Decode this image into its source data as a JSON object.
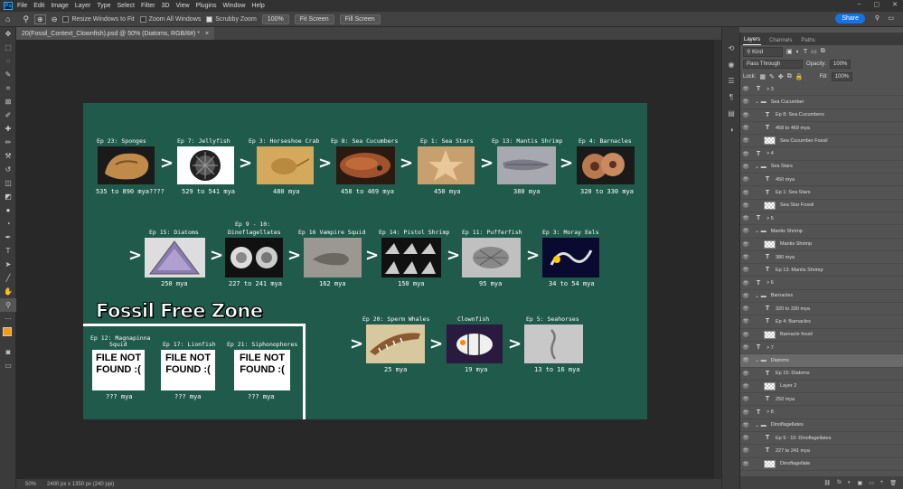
{
  "menubar": {
    "items": [
      "File",
      "Edit",
      "Image",
      "Layer",
      "Type",
      "Select",
      "Filter",
      "3D",
      "View",
      "Plugins",
      "Window",
      "Help"
    ]
  },
  "options": {
    "resize_windows": "Resize Windows to Fit",
    "zoom_all": "Zoom All Windows",
    "scrubby": "Scrubby Zoom",
    "zoom_pct": "100%",
    "fit_screen": "Fit Screen",
    "fill_screen": "Fill Screen",
    "share": "Share"
  },
  "document": {
    "tab": "20(Fossil_Context_Clownfish).psd @ 50% (Diatoms, RGB/8#) *",
    "close": "×"
  },
  "status": {
    "zoom": "50%",
    "info": "2400 px x 1350 px (240 ppi)"
  },
  "canvas": {
    "row1": [
      {
        "label": "Ep 23: Sponges",
        "mya": "535 to 890 mya????"
      },
      {
        "label": "Ep 7: Jellyfish",
        "mya": "529 to 541 mya"
      },
      {
        "label": "Ep 3: Horseshoe Crab",
        "mya": "480 mya"
      },
      {
        "label": "Ep 8: Sea Cucumbers",
        "mya": "458 to 469 mya"
      },
      {
        "label": "Ep 1: Sea Stars",
        "mya": "450 mya"
      },
      {
        "label": "Ep 13: Mantis Shrimp",
        "mya": "380 mya"
      },
      {
        "label": "Ep 4: Barnacles",
        "mya": "320 to 330 mya"
      }
    ],
    "row2": [
      {
        "label": "Ep 15: Diatoms",
        "mya": "250 mya"
      },
      {
        "label": "Ep 9 - 10:",
        "label2": "Dinoflagellates",
        "mya": "227 to 241 mya"
      },
      {
        "label": "Ep 16 Vampire Squid",
        "mya": "162 mya"
      },
      {
        "label": "Ep 14: Pistol Shrimp",
        "mya": "150 mya"
      },
      {
        "label": "Ep 11: Pufferfish",
        "mya": "95 mya"
      },
      {
        "label": "Ep 3: Moray Eels",
        "mya": "34 to 54 mya"
      }
    ],
    "row3": [
      {
        "label": "Ep 20: Sperm Whales",
        "mya": "25 mya"
      },
      {
        "label": "Clownfish",
        "mya": "19 mya"
      },
      {
        "label": "Ep 5: Seahorses",
        "mya": "13 to 16 mya"
      }
    ],
    "ffz_title": "Fossil Free Zone",
    "ffz": [
      {
        "label": "Ep 12: Magnapinna",
        "label2": "Squid",
        "nf": "FILE NOT FOUND :(",
        "mya": "??? mya"
      },
      {
        "label": "Ep 17: Lionfish",
        "nf": "FILE NOT FOUND :(",
        "mya": "??? mya"
      },
      {
        "label": "Ep 21: Siphonophores",
        "nf": "FILE NOT FOUND :(",
        "mya": "??? mya"
      }
    ],
    "arrow": ">"
  },
  "panel": {
    "tabs": [
      "Layers",
      "Channels",
      "Paths"
    ],
    "kind": "Kind",
    "blend": "Pass Through",
    "opacity_label": "Opacity:",
    "opacity": "100%",
    "lock_label": "Lock:",
    "fill_label": "Fill:",
    "fill": "100%",
    "layers": [
      {
        "type": "T",
        "name": "> 3",
        "indent": 0
      },
      {
        "type": "group",
        "name": "Sea Cucumber",
        "indent": 0
      },
      {
        "type": "T",
        "name": "Ep 8: Sea Cucumbers",
        "indent": 1
      },
      {
        "type": "T",
        "name": "458 to 469 mya",
        "indent": 1
      },
      {
        "type": "img",
        "name": "Sea Cucumber Fossil",
        "indent": 1
      },
      {
        "type": "T",
        "name": "> 4",
        "indent": 0
      },
      {
        "type": "group",
        "name": "Sea Stars",
        "indent": 0
      },
      {
        "type": "T",
        "name": "450 mya",
        "indent": 1
      },
      {
        "type": "T",
        "name": "Ep 1: Sea Stars",
        "indent": 1
      },
      {
        "type": "img",
        "name": "Sea Star Fossil",
        "indent": 1
      },
      {
        "type": "T",
        "name": "> 5",
        "indent": 0
      },
      {
        "type": "group",
        "name": "Mantis Shrimp",
        "indent": 0
      },
      {
        "type": "img",
        "name": "Mantis Shrimp",
        "indent": 1
      },
      {
        "type": "T",
        "name": "380 mya",
        "indent": 1
      },
      {
        "type": "T",
        "name": "Ep 13: Mantis Shrimp",
        "indent": 1
      },
      {
        "type": "T",
        "name": "> 6",
        "indent": 0
      },
      {
        "type": "group",
        "name": "Barnacles",
        "indent": 0
      },
      {
        "type": "T",
        "name": "320 to 330 mya",
        "indent": 1
      },
      {
        "type": "T",
        "name": "Ep 4: Barnacles",
        "indent": 1
      },
      {
        "type": "img",
        "name": "Barnacle fossil",
        "indent": 1
      },
      {
        "type": "T",
        "name": "> 7",
        "indent": 0
      },
      {
        "type": "group",
        "name": "Diatoms",
        "indent": 0,
        "selected": true
      },
      {
        "type": "T",
        "name": "Ep 15: Diatoms",
        "indent": 1
      },
      {
        "type": "img",
        "name": "Layer 2",
        "indent": 1
      },
      {
        "type": "T",
        "name": "250 mya",
        "indent": 1
      },
      {
        "type": "T",
        "name": "> 8",
        "indent": 0
      },
      {
        "type": "group",
        "name": "Dinoflagellates",
        "indent": 0
      },
      {
        "type": "T",
        "name": "Ep 9 - 10: Dinoflagellates",
        "indent": 1
      },
      {
        "type": "T",
        "name": "227 to 241 mya",
        "indent": 1
      },
      {
        "type": "img",
        "name": "Dinoflagellate",
        "indent": 1
      }
    ],
    "footer": [
      "fx",
      "◐",
      "▣",
      "▭",
      "+",
      "🗑"
    ]
  }
}
